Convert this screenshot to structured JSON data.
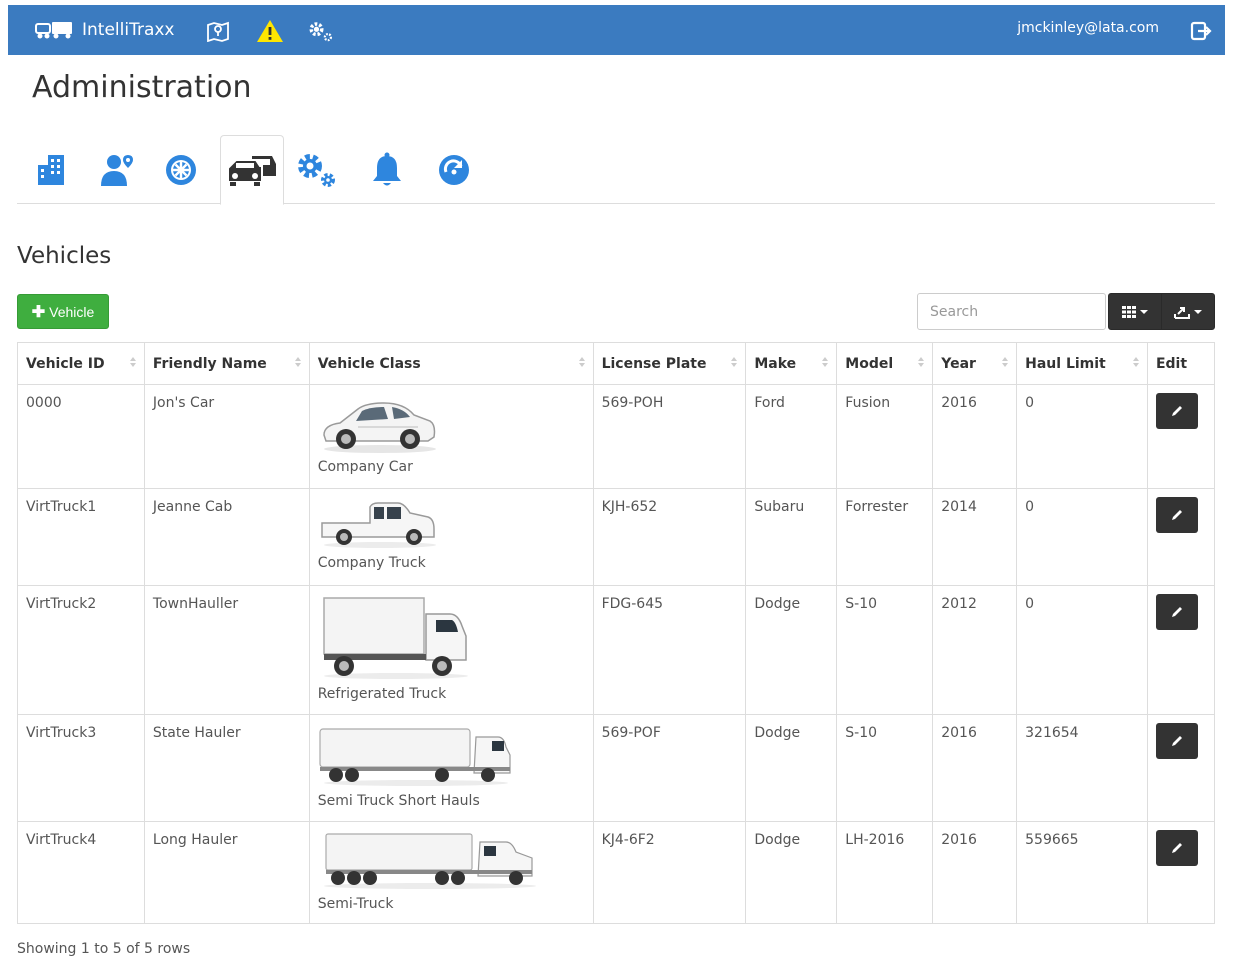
{
  "navbar": {
    "brand": "IntelliTraxx",
    "user_email": "jmckinley@lata.com",
    "bg_color": "#3b7bc0",
    "icons": [
      "map-icon",
      "warning-icon",
      "settings-gears-icon",
      "logout-icon"
    ]
  },
  "page": {
    "title": "Administration"
  },
  "tabs": [
    {
      "icon": "buildings-icon",
      "active": false
    },
    {
      "icon": "user-location-icon",
      "active": false
    },
    {
      "icon": "wheel-icon",
      "active": false
    },
    {
      "icon": "vehicles-icon",
      "active": true
    },
    {
      "icon": "gears-icon",
      "active": false
    },
    {
      "icon": "bell-icon",
      "active": false
    },
    {
      "icon": "sync-icon",
      "active": false
    }
  ],
  "section": {
    "title": "Vehicles",
    "add_button_label": "Vehicle",
    "search_placeholder": "Search"
  },
  "table": {
    "columns": [
      "Vehicle ID",
      "Friendly Name",
      "Vehicle Class",
      "License Plate",
      "Make",
      "Model",
      "Year",
      "Haul Limit",
      "Edit"
    ],
    "rows": [
      {
        "id": "0000",
        "name": "Jon's Car",
        "class": "Company Car",
        "plate": "569-POH",
        "make": "Ford",
        "model": "Fusion",
        "year": "2016",
        "haul": "0"
      },
      {
        "id": "VirtTruck1",
        "name": "Jeanne Cab",
        "class": "Company Truck",
        "plate": "KJH-652",
        "make": "Subaru",
        "model": "Forrester",
        "year": "2014",
        "haul": "0"
      },
      {
        "id": "VirtTruck2",
        "name": "TownHauller",
        "class": "Refrigerated Truck",
        "plate": "FDG-645",
        "make": "Dodge",
        "model": "S-10",
        "year": "2012",
        "haul": "0"
      },
      {
        "id": "VirtTruck3",
        "name": "State Hauler",
        "class": "Semi Truck Short Hauls",
        "plate": "569-POF",
        "make": "Dodge",
        "model": "S-10",
        "year": "2016",
        "haul": "321654"
      },
      {
        "id": "VirtTruck4",
        "name": "Long Hauler",
        "class": "Semi-Truck",
        "plate": "KJ4-6F2",
        "make": "Dodge",
        "model": "LH-2016",
        "year": "2016",
        "haul": "559665"
      }
    ]
  },
  "footer": {
    "pagination_info": "Showing 1 to 5 of 5 rows"
  }
}
